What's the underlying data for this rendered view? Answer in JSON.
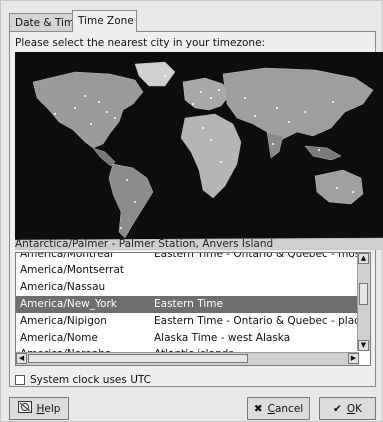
{
  "tabs": [
    {
      "label": "Date & Time",
      "active": false
    },
    {
      "label": "Time Zone",
      "active": true
    }
  ],
  "prompt": "Please select the nearest city in your timezone:",
  "map": {
    "description_icon": "world-map"
  },
  "selected_city": "Antarctica/Palmer - Palmer Station, Anvers Island",
  "timezone_list": {
    "rows": [
      {
        "city": "America/Montreal",
        "description": "Eastern Time - Ontario & Quebec - most locations",
        "selected": false,
        "partial": true
      },
      {
        "city": "America/Montserrat",
        "description": "",
        "selected": false
      },
      {
        "city": "America/Nassau",
        "description": "",
        "selected": false
      },
      {
        "city": "America/New_York",
        "description": "Eastern Time",
        "selected": true
      },
      {
        "city": "America/Nipigon",
        "description": "Eastern Time - Ontario & Quebec - places that",
        "selected": false
      },
      {
        "city": "America/Nome",
        "description": "Alaska Time - west Alaska",
        "selected": false
      },
      {
        "city": "America/Noronha",
        "description": "Atlantic islands",
        "selected": false,
        "partial": true
      }
    ]
  },
  "utc_checkbox": {
    "label": "System clock uses UTC",
    "checked": false
  },
  "buttons": {
    "help": {
      "mnemonic": "H",
      "rest": "elp"
    },
    "cancel": {
      "mnemonic": "C",
      "rest": "ancel"
    },
    "ok": {
      "mnemonic": "O",
      "rest": "K"
    }
  },
  "colors": {
    "selection": "#6e6e6e",
    "map_background": "#0d0d0d"
  }
}
